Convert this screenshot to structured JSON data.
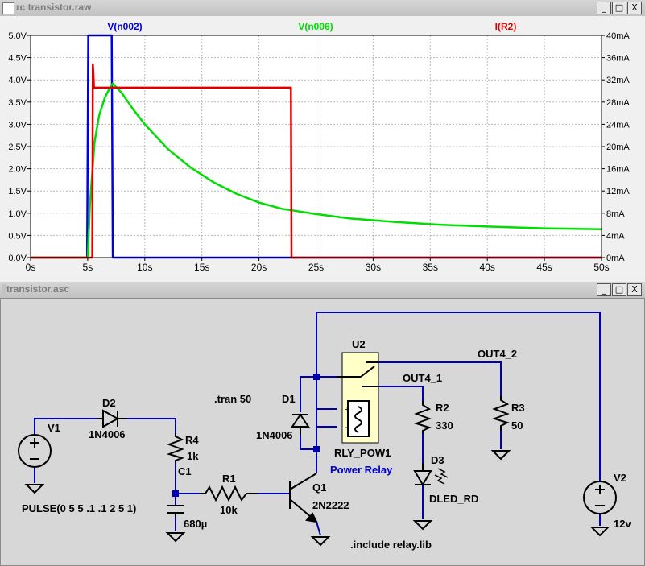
{
  "plot_window": {
    "title": "rc transistor.raw",
    "buttons": {
      "minimize": "_",
      "restore": "□",
      "close": "X"
    }
  },
  "schematic_window": {
    "title": "transistor.asc",
    "buttons": {
      "minimize": "_",
      "restore": "□",
      "close": "X"
    }
  },
  "colors": {
    "v_n002": "#0000e6",
    "v_n006": "#00dd00",
    "i_r2": "#dd0000",
    "wire": "#0000b0",
    "component": "#000000",
    "relay_box": "#ffffc8",
    "relay_label": "#0000cc"
  },
  "chart_data": {
    "type": "line",
    "x_ticks": [
      "0s",
      "5s",
      "10s",
      "15s",
      "20s",
      "25s",
      "30s",
      "35s",
      "40s",
      "45s",
      "50s"
    ],
    "y_left_ticks": [
      "0.0V",
      "0.5V",
      "1.0V",
      "1.5V",
      "2.0V",
      "2.5V",
      "3.0V",
      "3.5V",
      "4.0V",
      "4.5V",
      "5.0V"
    ],
    "y_right_ticks": [
      "0mA",
      "4mA",
      "8mA",
      "12mA",
      "16mA",
      "20mA",
      "24mA",
      "28mA",
      "32mA",
      "36mA",
      "40mA"
    ],
    "xlim": [
      0,
      50
    ],
    "ylim_left": [
      0,
      5
    ],
    "ylim_right": [
      0,
      40
    ],
    "series": [
      {
        "name": "V(n002)",
        "axis": "left",
        "color": "#0000e6",
        "x": [
          0,
          4.95,
          5.05,
          7.1,
          7.2,
          50
        ],
        "y": [
          0,
          0,
          5,
          5,
          0,
          0
        ]
      },
      {
        "name": "V(n006)",
        "axis": "left",
        "color": "#00dd00",
        "x": [
          0,
          5.0,
          5.2,
          5.6,
          6.0,
          6.5,
          7.0,
          7.2,
          8,
          9,
          10,
          12,
          14,
          16,
          18,
          20,
          22,
          25,
          28,
          32,
          36,
          40,
          45,
          50
        ],
        "y": [
          0,
          0,
          1.2,
          2.6,
          3.2,
          3.6,
          3.85,
          3.92,
          3.7,
          3.33,
          3.0,
          2.45,
          2.03,
          1.7,
          1.44,
          1.24,
          1.1,
          0.98,
          0.88,
          0.8,
          0.74,
          0.7,
          0.66,
          0.64
        ]
      },
      {
        "name": "I(R2)",
        "axis": "right",
        "color": "#dd0000",
        "x": [
          0,
          5.4,
          5.45,
          5.5,
          5.55,
          22.8,
          22.85,
          50
        ],
        "y": [
          0,
          0,
          34.8,
          33,
          30.6,
          30.6,
          0,
          0
        ]
      }
    ]
  },
  "schematic": {
    "labels": {
      "v1_name": "V1",
      "v1_value": "PULSE(0 5 5 .1 .1 2 5 1)",
      "d2_name": "D2",
      "d2_value": "1N4006",
      "r4_name": "R4",
      "r4_value": "1k",
      "c1_name": "C1",
      "c1_value": "680µ",
      "r1_name": "R1",
      "r1_value": "10k",
      "q1_name": "Q1",
      "q1_value": "2N2222",
      "d1_name": "D1",
      "d1_value": "1N4006",
      "tran": ".tran 50",
      "u2_name": "U2",
      "u2_value": "RLY_POW1",
      "u2_desc": "Power Relay",
      "out4_1": "OUT4_1",
      "out4_2": "OUT4_2",
      "r2_name": "R2",
      "r2_value": "330",
      "r3_name": "R3",
      "r3_value": "50",
      "d3_name": "D3",
      "d3_value": "DLED_RD",
      "v2_name": "V2",
      "v2_value": "12v",
      "include": ".include relay.lib"
    }
  }
}
